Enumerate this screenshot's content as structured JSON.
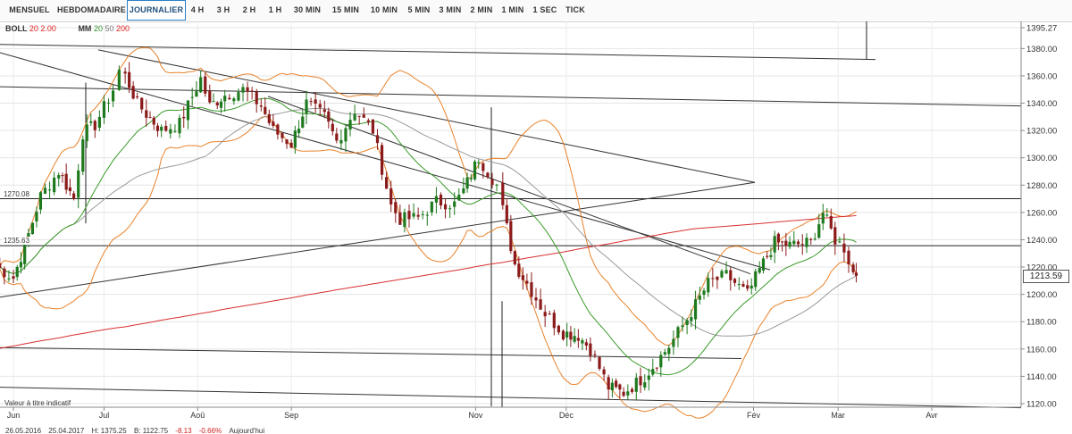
{
  "tabs": [
    {
      "label": "MENSUEL",
      "active": false
    },
    {
      "label": "HEBDOMADAIRE",
      "active": false
    },
    {
      "label": "JOURNALIER",
      "active": true
    },
    {
      "label": "4 H",
      "active": false
    },
    {
      "label": "3 H",
      "active": false
    },
    {
      "label": "2 H",
      "active": false
    },
    {
      "label": "1 H",
      "active": false
    },
    {
      "label": "30 MIN",
      "active": false
    },
    {
      "label": "15 MIN",
      "active": false
    },
    {
      "label": "10 MIN",
      "active": false
    },
    {
      "label": "5 MIN",
      "active": false
    },
    {
      "label": "3 MIN",
      "active": false
    },
    {
      "label": "2 MIN",
      "active": false
    },
    {
      "label": "1 MIN",
      "active": false
    },
    {
      "label": "1 SEC",
      "active": false
    },
    {
      "label": "TICK",
      "active": false
    }
  ],
  "legend": {
    "boll_name": "BOLL",
    "boll_p1": "20",
    "boll_p2": "2.00",
    "mm_name": "MM",
    "mm_p1": "20",
    "mm_p2": "50",
    "mm_p3": "200"
  },
  "note": "Valeur à titre indicatif",
  "footer": {
    "range": "26.05.2016",
    "to": "25.04.2017",
    "high": "H: 1375.25",
    "low": "B: 1122.75",
    "change": "-8.13",
    "pct": "-0.66%",
    "today": "Aujourd'hui"
  },
  "colors": {
    "bull": "#1f7a1f",
    "bear": "#8b1a1a",
    "boll": "#e8822a",
    "mm20": "#3a9a2a",
    "mm50": "#9a9a9a",
    "mm200": "#d83030",
    "trend": "#333333"
  },
  "chart_data": {
    "type": "candlestick",
    "instrument_price": "1213.59",
    "ylim": [
      1115,
      1400
    ],
    "y_ticks": [
      "1395.27",
      "1380.00",
      "1360.00",
      "1340.00",
      "1320.00",
      "1300.00",
      "1280.00",
      "1260.00",
      "1240.00",
      "1220.00",
      "1213.59",
      "1200.00",
      "1180.00",
      "1160.00",
      "1140.00",
      "1120.00"
    ],
    "x_labels": [
      "Jun",
      "Jul",
      "Aoû",
      "Sep",
      "Nov",
      "Déc",
      "Fév",
      "Mar",
      "Avr"
    ],
    "x_label_dates": [
      "2016-06-01",
      "2016-07-01",
      "2016-08-01",
      "2016-09-01",
      "2016-11-01",
      "2016-12-01",
      "2017-02-01",
      "2017-03-01",
      "2017-04-01"
    ],
    "date_range": [
      "2016-05-26",
      "2017-04-25"
    ],
    "horizontal_levels": [
      {
        "label": "1270.08",
        "value": 1270.08
      },
      {
        "label": "1235.63",
        "value": 1235.63
      }
    ],
    "closes": [
      {
        "date": "2016-05-26",
        "c": 1221
      },
      {
        "date": "2016-06-01",
        "c": 1212
      },
      {
        "date": "2016-06-06",
        "c": 1244
      },
      {
        "date": "2016-06-10",
        "c": 1272
      },
      {
        "date": "2016-06-16",
        "c": 1290
      },
      {
        "date": "2016-06-21",
        "c": 1270
      },
      {
        "date": "2016-06-24",
        "c": 1318
      },
      {
        "date": "2016-06-28",
        "c": 1324
      },
      {
        "date": "2016-07-04",
        "c": 1350
      },
      {
        "date": "2016-07-06",
        "c": 1364
      },
      {
        "date": "2016-07-08",
        "c": 1360
      },
      {
        "date": "2016-07-12",
        "c": 1340
      },
      {
        "date": "2016-07-15",
        "c": 1332
      },
      {
        "date": "2016-07-20",
        "c": 1320
      },
      {
        "date": "2016-07-26",
        "c": 1325
      },
      {
        "date": "2016-08-02",
        "c": 1358
      },
      {
        "date": "2016-08-05",
        "c": 1338
      },
      {
        "date": "2016-08-10",
        "c": 1346
      },
      {
        "date": "2016-08-16",
        "c": 1350
      },
      {
        "date": "2016-08-22",
        "c": 1338
      },
      {
        "date": "2016-08-26",
        "c": 1320
      },
      {
        "date": "2016-09-01",
        "c": 1310
      },
      {
        "date": "2016-09-06",
        "c": 1340
      },
      {
        "date": "2016-09-12",
        "c": 1330
      },
      {
        "date": "2016-09-16",
        "c": 1312
      },
      {
        "date": "2016-09-22",
        "c": 1335
      },
      {
        "date": "2016-09-28",
        "c": 1320
      },
      {
        "date": "2016-10-04",
        "c": 1265
      },
      {
        "date": "2016-10-07",
        "c": 1255
      },
      {
        "date": "2016-10-13",
        "c": 1256
      },
      {
        "date": "2016-10-19",
        "c": 1268
      },
      {
        "date": "2016-10-25",
        "c": 1266
      },
      {
        "date": "2016-10-28",
        "c": 1276
      },
      {
        "date": "2016-11-02",
        "c": 1300
      },
      {
        "date": "2016-11-08",
        "c": 1280
      },
      {
        "date": "2016-11-10",
        "c": 1262
      },
      {
        "date": "2016-11-14",
        "c": 1222
      },
      {
        "date": "2016-11-18",
        "c": 1208
      },
      {
        "date": "2016-11-24",
        "c": 1186
      },
      {
        "date": "2016-11-30",
        "c": 1172
      },
      {
        "date": "2016-12-05",
        "c": 1170
      },
      {
        "date": "2016-12-09",
        "c": 1160
      },
      {
        "date": "2016-12-15",
        "c": 1132
      },
      {
        "date": "2016-12-20",
        "c": 1128
      },
      {
        "date": "2016-12-27",
        "c": 1140
      },
      {
        "date": "2017-01-04",
        "c": 1162
      },
      {
        "date": "2017-01-10",
        "c": 1182
      },
      {
        "date": "2017-01-17",
        "c": 1208
      },
      {
        "date": "2017-01-23",
        "c": 1214
      },
      {
        "date": "2017-01-30",
        "c": 1200
      },
      {
        "date": "2017-02-03",
        "c": 1218
      },
      {
        "date": "2017-02-08",
        "c": 1238
      },
      {
        "date": "2017-02-13",
        "c": 1236
      },
      {
        "date": "2017-02-20",
        "c": 1238
      },
      {
        "date": "2017-02-24",
        "c": 1260
      },
      {
        "date": "2017-02-28",
        "c": 1240
      },
      {
        "date": "2017-03-03",
        "c": 1234
      },
      {
        "date": "2017-03-06",
        "c": 1216
      },
      {
        "date": "2017-03-07",
        "c": 1213.59
      }
    ]
  }
}
